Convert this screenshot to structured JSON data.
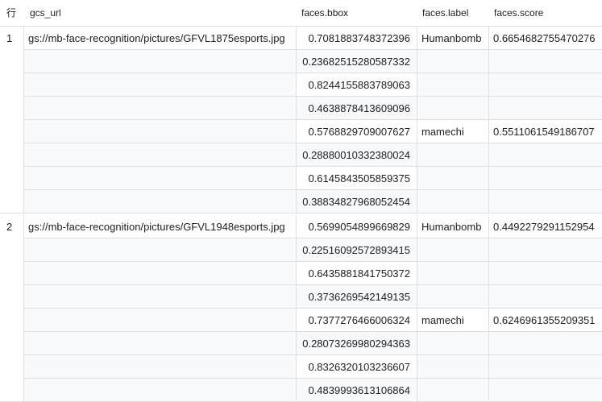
{
  "columns": {
    "row": "行",
    "gcs_url": "gcs_url",
    "bbox": "faces.bbox",
    "label": "faces.label",
    "score": "faces.score"
  },
  "rows": [
    {
      "row_number": "1",
      "gcs_url": "gs://mb-face-recognition/pictures/GFVL1875esports.jpg",
      "faces": [
        {
          "bbox": [
            "0.7081883748372396",
            "0.23682515280587332",
            "0.8244155883789063",
            "0.4638878413609096"
          ],
          "label": "Humanbomb",
          "score": "0.6654682755470276"
        },
        {
          "bbox": [
            "0.5768829709007627",
            "0.28880010332380024",
            "0.6145843505859375",
            "0.38834827968052454"
          ],
          "label": "mamechi",
          "score": "0.5511061549186707"
        }
      ]
    },
    {
      "row_number": "2",
      "gcs_url": "gs://mb-face-recognition/pictures/GFVL1948esports.jpg",
      "faces": [
        {
          "bbox": [
            "0.5699054899669829",
            "0.22516092572893415",
            "0.6435881841750372",
            "0.3736269542149135"
          ],
          "label": "Humanbomb",
          "score": "0.4492279291152954"
        },
        {
          "bbox": [
            "0.7377276466006324",
            "0.28073269980294363",
            "0.8326320103236607",
            "0.4839993613106864"
          ],
          "label": "mamechi",
          "score": "0.6246961355209351"
        }
      ]
    }
  ]
}
